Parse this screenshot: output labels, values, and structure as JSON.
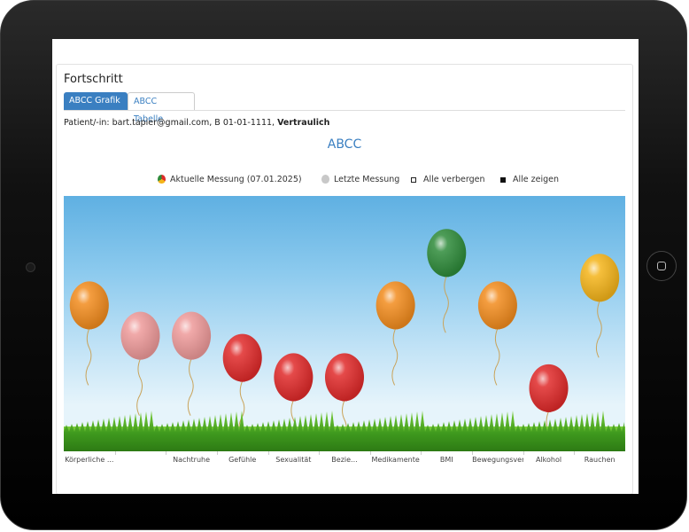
{
  "panel": {
    "title": "Fortschritt",
    "tabs": [
      {
        "label": "ABCC Grafik",
        "active": true
      },
      {
        "label": "ABCC Tabelle",
        "active": false
      }
    ]
  },
  "patient": {
    "prefix": "Patient/-in: bart.tapier@gmail.com, B 01-01-1111,",
    "confidential": "Vertraulich"
  },
  "chart_data": {
    "type": "scatter",
    "title": "ABCC",
    "legend": [
      {
        "label": "Aktuelle Messung (07.01.2025)",
        "icon": "multicolor-balloon-icon"
      },
      {
        "label": "Letzte Messung",
        "icon": "gray-balloon-icon"
      },
      {
        "label": "Alle verbergen",
        "icon": "empty-square-icon"
      },
      {
        "label": "Alle zeigen",
        "icon": "filled-square-icon"
      }
    ],
    "categories": [
      "Körperliche ...",
      "",
      "Nachtruhe",
      "Gefühle",
      "Sexualität",
      "Bezie...",
      "Medikamente",
      "BMI",
      "Bewegungsverhalten",
      "Alkohol",
      "Rauchen"
    ],
    "series": [
      {
        "name": "Aktuelle Messung (07.01.2025)",
        "values": [
          4.0,
          2.9,
          2.9,
          2.1,
          1.4,
          1.4,
          4.0,
          5.9,
          4.0,
          1.0,
          5.0
        ]
      }
    ],
    "colors": [
      "#f28c1e",
      "#ee9a9a",
      "#ee9a9a",
      "#e02a2a",
      "#e02a2a",
      "#e02a2a",
      "#f28c1e",
      "#2e8b3a",
      "#f28c1e",
      "#e02a2a",
      "#f4b41a"
    ],
    "ylim": [
      0,
      7
    ],
    "background": "sky-with-grass"
  }
}
